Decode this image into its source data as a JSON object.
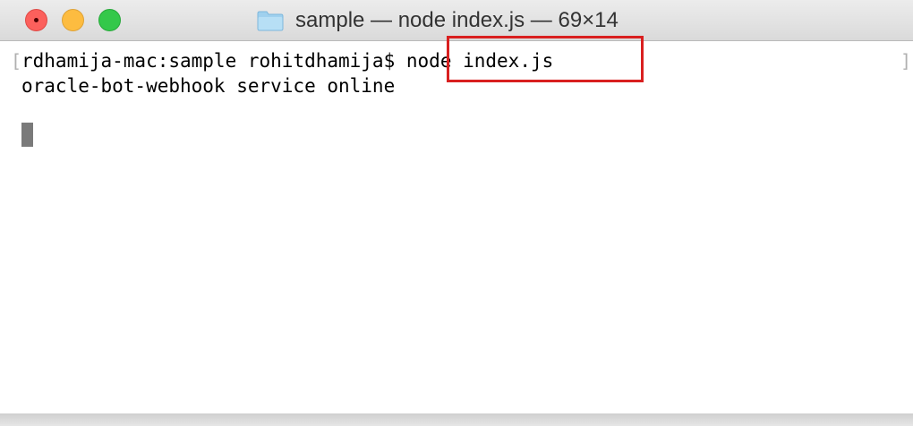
{
  "window": {
    "title": "sample — node index.js — 69×14",
    "title_icon": "folder-icon",
    "traffic_lights": {
      "close_color": "#fc605c",
      "minimize_color": "#fdbc40",
      "maximize_color": "#34c84a"
    }
  },
  "terminal": {
    "prompt": "rdhamija-mac:sample rohitdhamija$",
    "command": "node index.js",
    "output_lines": [
      "oracle-bot-webhook service online"
    ],
    "mark_bracket_left": "[",
    "mark_bracket_right": "]"
  },
  "annotation": {
    "highlight_color": "#d92020",
    "highlighted_text": "node index.js"
  }
}
